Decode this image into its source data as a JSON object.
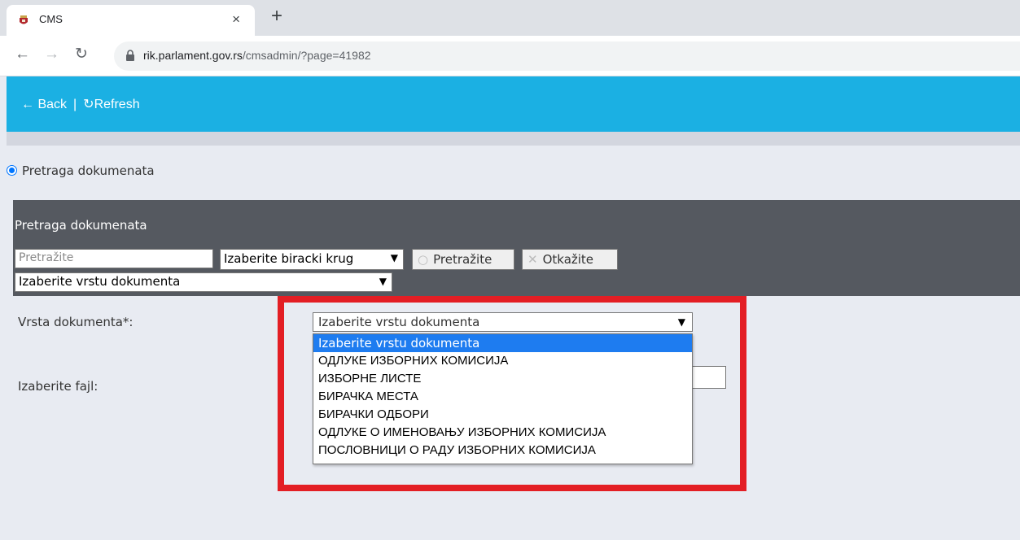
{
  "browser": {
    "tab_title": "CMS",
    "tab_close": "×",
    "new_tab": "+",
    "url_host": "rik.parlament.gov.rs",
    "url_path": "/cmsadmin/?page=41982"
  },
  "app": {
    "back_label": "← Back",
    "separator": "|",
    "refresh_label": "Refresh"
  },
  "radio": {
    "label": "Pretraga dokumenata"
  },
  "search_panel": {
    "title": "Pretraga dokumenata",
    "search_placeholder": "Pretražite",
    "district_select": "Izaberite biracki krug",
    "search_button": "Pretražite",
    "cancel_button": "Otkažite",
    "doctype_select": "Izaberite vrstu dokumenta"
  },
  "form": {
    "doctype_label": "Vrsta dokumenta*:",
    "file_label": "Izaberite fajl:",
    "doctype_value": "Izaberite vrstu dokumenta",
    "options": [
      "Izaberite vrstu dokumenta",
      "ОДЛУКЕ ИЗБОРНИХ КОМИСИЈА",
      "ИЗБОРНЕ ЛИСТЕ",
      "БИРАЧКА МЕСТА",
      "БИРАЧКИ ОДБОРИ",
      "ОДЛУКЕ О ИМЕНОВАЊУ ИЗБОРНИХ КОМИСИЈА",
      "ПОСЛОВНИЦИ О РАДУ ИЗБОРНИХ КОМИСИЈА"
    ],
    "selected_index": 0
  },
  "colors": {
    "appbar": "#1bb0e3",
    "panel": "#555960",
    "highlight": "#e31e24",
    "option_selected": "#1e7cf0"
  }
}
